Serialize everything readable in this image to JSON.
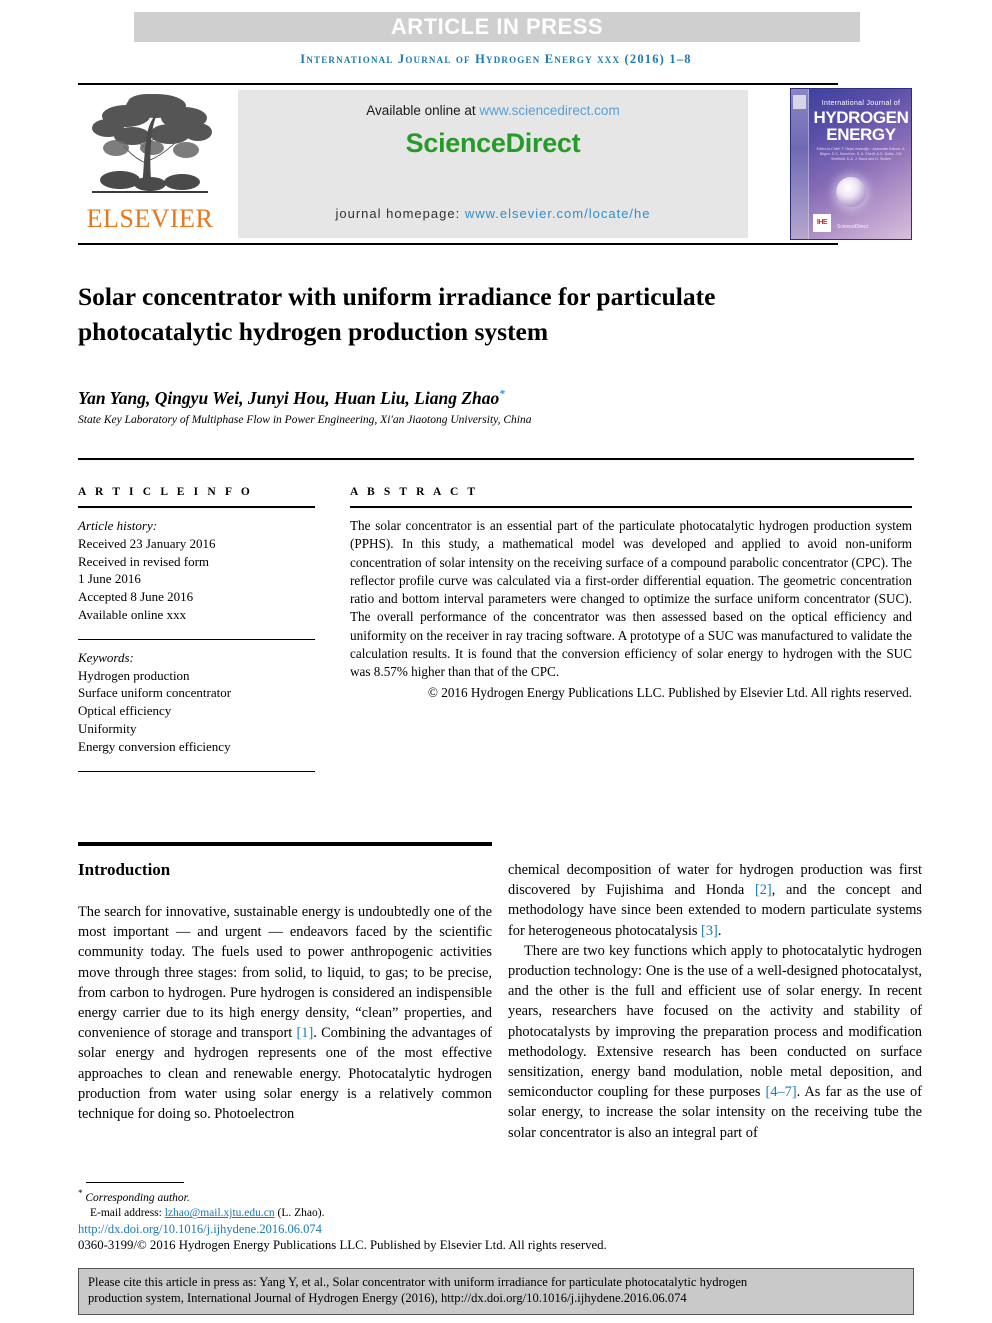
{
  "banner": {
    "article_in_press": "ARTICLE IN PRESS",
    "running_head": "International Journal of Hydrogen Energy xxx (2016) 1–8"
  },
  "masthead": {
    "publisher_name": "ELSEVIER",
    "available_prefix": "Available online at ",
    "available_url": "www.sciencedirect.com",
    "brand": "ScienceDirect",
    "homepage_prefix": "journal homepage: ",
    "homepage_url": "www.elsevier.com/locate/he"
  },
  "cover": {
    "line1": "International Journal of",
    "line2": "HYDROGEN",
    "line3": "ENERGY",
    "editors": "Editor-in-Chief: T. Nejat Veziroğlu · Associate Editors: A. Bilgen, D.S. Sunshine, S. A. Sherif, A.G. Dutta, J.W. Sheffield, D.A. J. Rand and D. Stolten",
    "badge": "IHE",
    "sciencedirect": "ScienceDirect"
  },
  "article": {
    "title": "Solar concentrator with uniform irradiance for particulate photocatalytic hydrogen production system",
    "authors": "Yan Yang, Qingyu Wei, Junyi Hou, Huan Liu, Liang Zhao",
    "corresponding_marker": "*",
    "affiliation": "State Key Laboratory of Multiphase Flow in Power Engineering, Xi'an Jiaotong University, China"
  },
  "article_info": {
    "heading": "A R T I C L E   I N F O",
    "history_label": "Article history:",
    "history": [
      "Received 23 January 2016",
      "Received in revised form",
      "1 June 2016",
      "Accepted 8 June 2016",
      "Available online xxx"
    ],
    "keywords_label": "Keywords:",
    "keywords": [
      "Hydrogen production",
      "Surface uniform concentrator",
      "Optical efficiency",
      "Uniformity",
      "Energy conversion efficiency"
    ]
  },
  "abstract": {
    "heading": "A B S T R A C T",
    "text": "The solar concentrator is an essential part of the particulate photocatalytic hydrogen production system (PPHS). In this study, a mathematical model was developed and applied to avoid non-uniform concentration of solar intensity on the receiving surface of a compound parabolic concentrator (CPC). The reflector profile curve was calculated via a first-order differential equation. The geometric concentration ratio and bottom interval parameters were changed to optimize the surface uniform concentrator (SUC). The overall performance of the concentrator was then assessed based on the optical efficiency and uniformity on the receiver in ray tracing software. A prototype of a SUC was manufactured to validate the calculation results. It is found that the conversion efficiency of solar energy to hydrogen with the SUC was 8.57% higher than that of the CPC.",
    "copyright": "© 2016 Hydrogen Energy Publications LLC. Published by Elsevier Ltd. All rights reserved."
  },
  "body": {
    "section_heading": "Introduction",
    "left_paragraph_1a": "The search for innovative, sustainable energy is undoubtedly one of the most important — and urgent — endeavors faced by the scientific community today. The fuels used to power anthropogenic activities move through three stages: from solid, to liquid, to gas; to be precise, from carbon to hydrogen. Pure hydrogen is considered an indispensible energy carrier due to its high energy density, “clean” properties, and convenience of storage and transport ",
    "ref1": "[1]",
    "left_paragraph_1b": ". Combining the advantages of solar energy and hydrogen represents one of the most effective approaches to clean and renewable energy. Photocatalytic hydrogen production from water using solar energy is a relatively common technique for doing so. Photoelectron",
    "right_paragraph_1a": "chemical decomposition of water for hydrogen production was first discovered by Fujishima and Honda ",
    "ref2": "[2]",
    "right_paragraph_1b": ", and the concept and methodology have since been extended to modern particulate systems for heterogeneous photocatalysis ",
    "ref3": "[3]",
    "right_paragraph_1c": ".",
    "right_paragraph_2a": "There are two key functions which apply to photocatalytic hydrogen production technology: One is the use of a well-designed photocatalyst, and the other is the full and efficient use of solar energy. In recent years, researchers have focused on the activity and stability of photocatalysts by improving the preparation process and modification methodology. Extensive research has been conducted on surface sensitization, energy band modulation, noble metal deposition, and semiconductor coupling for these purposes ",
    "ref47": "[4–7]",
    "right_paragraph_2b": ". As far as the use of solar energy, to increase the solar intensity on the receiving tube the solar concentrator is also an integral part of"
  },
  "footer": {
    "corresponding_label": "Corresponding author.",
    "email_label": "E-mail address: ",
    "email": "lzhao@mail.xjtu.edu.cn",
    "email_suffix": " (L. Zhao).",
    "doi": "http://dx.doi.org/10.1016/j.ijhydene.2016.06.074",
    "issn_line": "0360-3199/© 2016 Hydrogen Energy Publications LLC. Published by Elsevier Ltd. All rights reserved."
  },
  "cite_box": {
    "line1": "Please cite this article in press as: Yang Y, et al., Solar concentrator with uniform irradiance for particulate photocatalytic hydrogen",
    "line2": "production system, International Journal of Hydrogen Energy (2016), http://dx.doi.org/10.1016/j.ijhydene.2016.06.074"
  },
  "colors": {
    "journal_blue": "#1a7bb0",
    "link_blue": "#2f8fcf",
    "sciencedirect_green": "#279b27",
    "elsevier_orange": "#e8761a",
    "banner_grey": "#cfcfcf",
    "cite_box_grey": "#c9c9c9"
  }
}
